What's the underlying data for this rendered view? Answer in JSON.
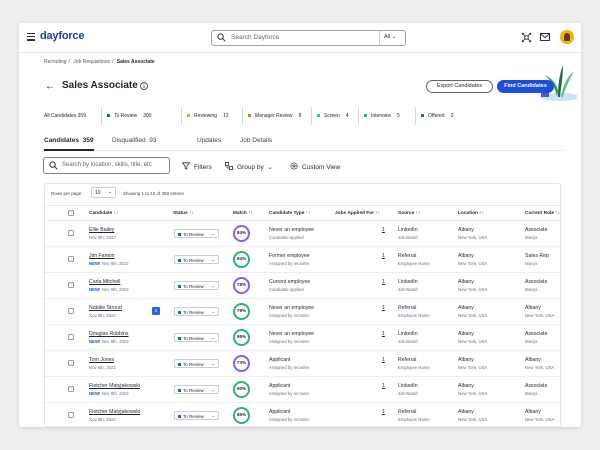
{
  "app": {
    "logo": "dayforce",
    "search_placeholder": "Search Dayforce",
    "search_scope": "All"
  },
  "breadcrumb": [
    "Recruiting",
    "Job Requisitions",
    "Sales Associate"
  ],
  "breadcrumb_sep": "/",
  "page": {
    "back_glyph": "←",
    "title": "Sales Associate",
    "export_label": "Export Candidates",
    "find_label": "Find Candidates"
  },
  "stages": [
    {
      "label": "All Candidates",
      "count": "359",
      "color": ""
    },
    {
      "label": "To Review",
      "count": "300",
      "color": "#2557d6"
    },
    {
      "label": "Reviewing",
      "count": "12",
      "color": "#f5a524"
    },
    {
      "label": "Manager Review",
      "count": "8",
      "color": "#ef6c2c"
    },
    {
      "label": "Screen",
      "count": "4",
      "color": "#3db4e5"
    },
    {
      "label": "Interview",
      "count": "5",
      "color": "#2bb673"
    },
    {
      "label": "Offered",
      "count": "3",
      "color": "#1a7f4b"
    }
  ],
  "tabs": [
    {
      "label": "Candidates",
      "count": "359"
    },
    {
      "label": "Disqualified",
      "count": "93"
    },
    {
      "label": "Updates",
      "count": ""
    },
    {
      "label": "Job Details",
      "count": ""
    }
  ],
  "toolbar": {
    "search_placeholder": "Search by location, skills, title, etc",
    "filters": "Filters",
    "group_by": "Group by",
    "custom_view": "Custom View"
  },
  "table": {
    "rows_per_page_label": "Rows per page",
    "rows_per_page_value": "10",
    "showing": "Showing 1 to 10 of 359 entries",
    "sort_glyph": "↑↓",
    "columns": [
      "Candidate",
      "Status",
      "Match",
      "Candidate Type",
      "Jobs Applied For",
      "Source",
      "Location",
      "Current Role"
    ],
    "rows": [
      {
        "name": "Ellie Bailey",
        "new": "",
        "date": "Nov 9th, 2022",
        "badge": "",
        "status": "To Review",
        "match": "84%",
        "ring": "purple",
        "type": "Never an employee",
        "type_sub": "Candidate applied",
        "jobs": "1",
        "source": "LinkedIn",
        "source_sub": "Job Board",
        "city": "Albany",
        "state": "New York, USA",
        "role": "Associate",
        "company": "Macys"
      },
      {
        "name": "Jim Fanton",
        "new": "NEW!",
        "date": "Nov 9th, 2022",
        "badge": "",
        "status": "To Review",
        "match": "84%",
        "ring": "green",
        "type": "Former employee",
        "type_sub": "Assigned by recruiter",
        "jobs": "1",
        "source": "Referral",
        "source_sub": "Employee Name",
        "city": "Albany",
        "state": "New York, USA",
        "role": "Sales Rep",
        "company": "Macys"
      },
      {
        "name": "Carla Mitchell",
        "new": "NEW!",
        "date": "Nov 9th, 2022",
        "badge": "",
        "status": "To Review",
        "match": "78%",
        "ring": "purple",
        "type": "Current employee",
        "type_sub": "Candidate applied",
        "jobs": "1",
        "source": "LinkedIn",
        "source_sub": "Job Board",
        "city": "Albany",
        "state": "New York, USA",
        "role": "Associate",
        "company": "Macys"
      },
      {
        "name": "Natalie Stroud",
        "new": "",
        "date": "Nov 8th, 2022",
        "badge": "2",
        "status": "To Review",
        "match": "78%",
        "ring": "green",
        "type": "Never an employee",
        "type_sub": "Assigned by recruiter",
        "jobs": "1",
        "source": "Referral",
        "source_sub": "Employee Name",
        "city": "Albany",
        "state": "New York, USA",
        "role": "Albany",
        "company": "New York, USA"
      },
      {
        "name": "Douglas Robbins",
        "new": "NEW!",
        "date": "Nov 8th, 2022",
        "badge": "",
        "status": "To Review",
        "match": "98%",
        "ring": "green",
        "type": "Never an employee",
        "type_sub": "Assigned by recruiter",
        "jobs": "1",
        "source": "LinkedIn",
        "source_sub": "Job Board",
        "city": "Albany",
        "state": "New York, USA",
        "role": "Associate",
        "company": "Macys"
      },
      {
        "name": "Tom Jones",
        "new": "",
        "date": "Nov 8th, 2022",
        "badge": "",
        "status": "To Review",
        "match": "73%",
        "ring": "purple",
        "type": "Applicant",
        "type_sub": "Assigned by recruiter",
        "jobs": "1",
        "source": "Referral",
        "source_sub": "Employee Name",
        "city": "Albany",
        "state": "New York, USA",
        "role": "Albany",
        "company": "New York, USA"
      },
      {
        "name": "Fletcher Matyjakowski",
        "new": "NEW!",
        "date": "Nov 8th, 2022",
        "badge": "",
        "status": "To Review",
        "match": "90%",
        "ring": "green",
        "type": "Applicant",
        "type_sub": "Assigned by recruiter",
        "jobs": "1",
        "source": "LinkedIn",
        "source_sub": "Job Board",
        "city": "Albany",
        "state": "New York, USA",
        "role": "Associate",
        "company": "Macys"
      },
      {
        "name": "Fletcher Matyjakowski",
        "new": "",
        "date": "Nov 8th, 2022",
        "badge": "",
        "status": "To Review",
        "match": "85%",
        "ring": "green",
        "type": "Applicant",
        "type_sub": "Assigned by recruiter",
        "jobs": "1",
        "source": "Referral",
        "source_sub": "Employee Name",
        "city": "Albany",
        "state": "New York, USA",
        "role": "Albany",
        "company": "New York, USA"
      }
    ]
  }
}
